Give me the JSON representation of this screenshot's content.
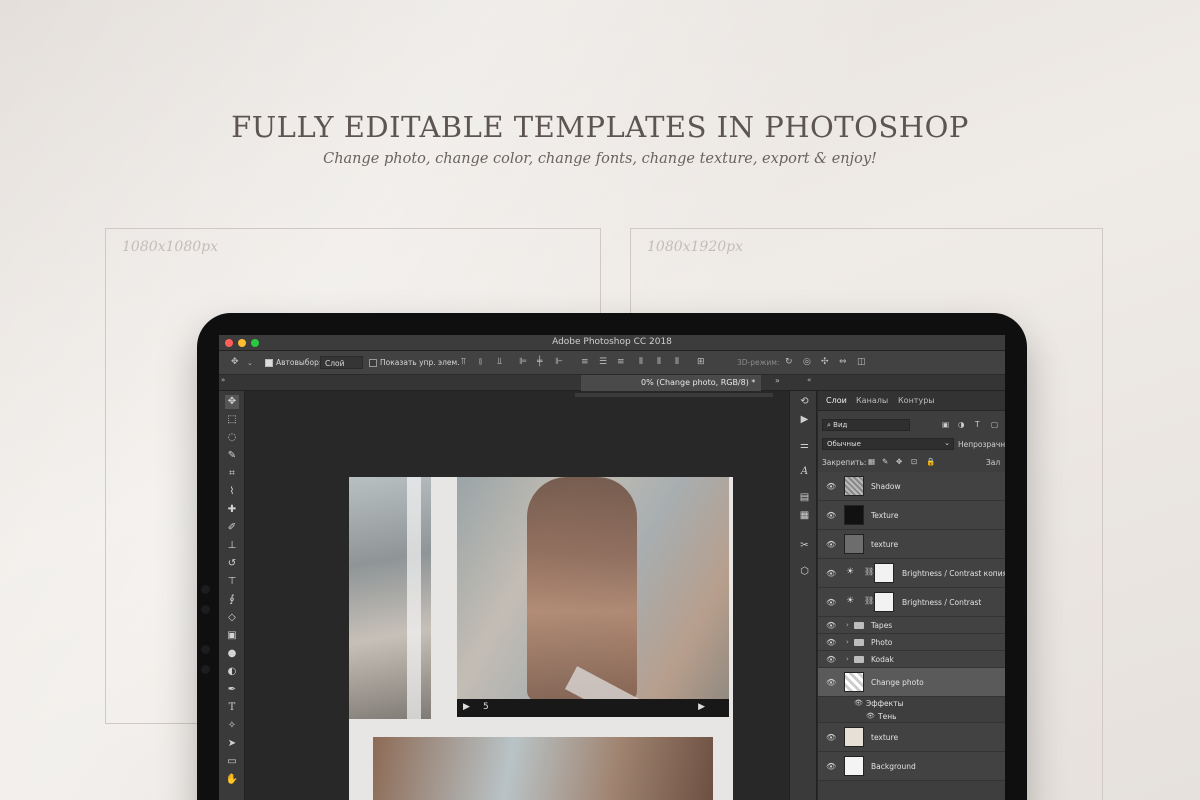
{
  "heading": "FULLY EDITABLE TEMPLATES IN PHOTOSHOP",
  "subheading": "Change photo, change color, change fonts, change texture, export & enjoy!",
  "frames": [
    {
      "label": "1080x1080px"
    },
    {
      "label": "1080x1920px"
    }
  ],
  "app": {
    "title": "Adobe Photoshop CC 2018",
    "doc_tab": "0% (Change photo, RGB/8) *",
    "options": {
      "auto_select_label": "Автовыбор:",
      "auto_select_value": "Слой",
      "show_transform_label": "Показать упр. элем.",
      "mode_3d_label": "3D-режим:"
    }
  },
  "layers_panel": {
    "tabs": [
      "Слои",
      "Каналы",
      "Контуры"
    ],
    "filter_label": "Вид",
    "blend_mode": "Обычные",
    "opacity_label": "Непрозрачн",
    "lock_label": "Закрепить:",
    "fill_label": "Зал",
    "layers": [
      {
        "name": "Shadow",
        "type": "layer",
        "visible": true
      },
      {
        "name": "Texture",
        "type": "layer",
        "visible": true
      },
      {
        "name": "texture",
        "type": "layer",
        "visible": true
      },
      {
        "name": "Brightness / Contrast копия",
        "type": "adjustment",
        "visible": true
      },
      {
        "name": "Brightness / Contrast",
        "type": "adjustment",
        "visible": true
      },
      {
        "name": "Tapes",
        "type": "group",
        "visible": true
      },
      {
        "name": "Photo",
        "type": "group",
        "visible": true
      },
      {
        "name": "Kodak",
        "type": "group",
        "visible": true
      },
      {
        "name": "Change photo",
        "type": "smart",
        "visible": true,
        "selected": true
      },
      {
        "name": "texture",
        "type": "layer",
        "visible": true
      },
      {
        "name": "Background",
        "type": "layer",
        "visible": true
      }
    ],
    "effects_label": "Эффекты",
    "shadow_effect_label": "Тень"
  },
  "canvas": {
    "frame_number": "5"
  },
  "colors": {
    "background": "#ebe6e2",
    "heading": "#5d5552",
    "tablet_bezel": "#0f0f10",
    "ps_dark": "#282828",
    "traffic_close": "#ff5f57",
    "traffic_min": "#febc2e",
    "traffic_max": "#28c840"
  }
}
